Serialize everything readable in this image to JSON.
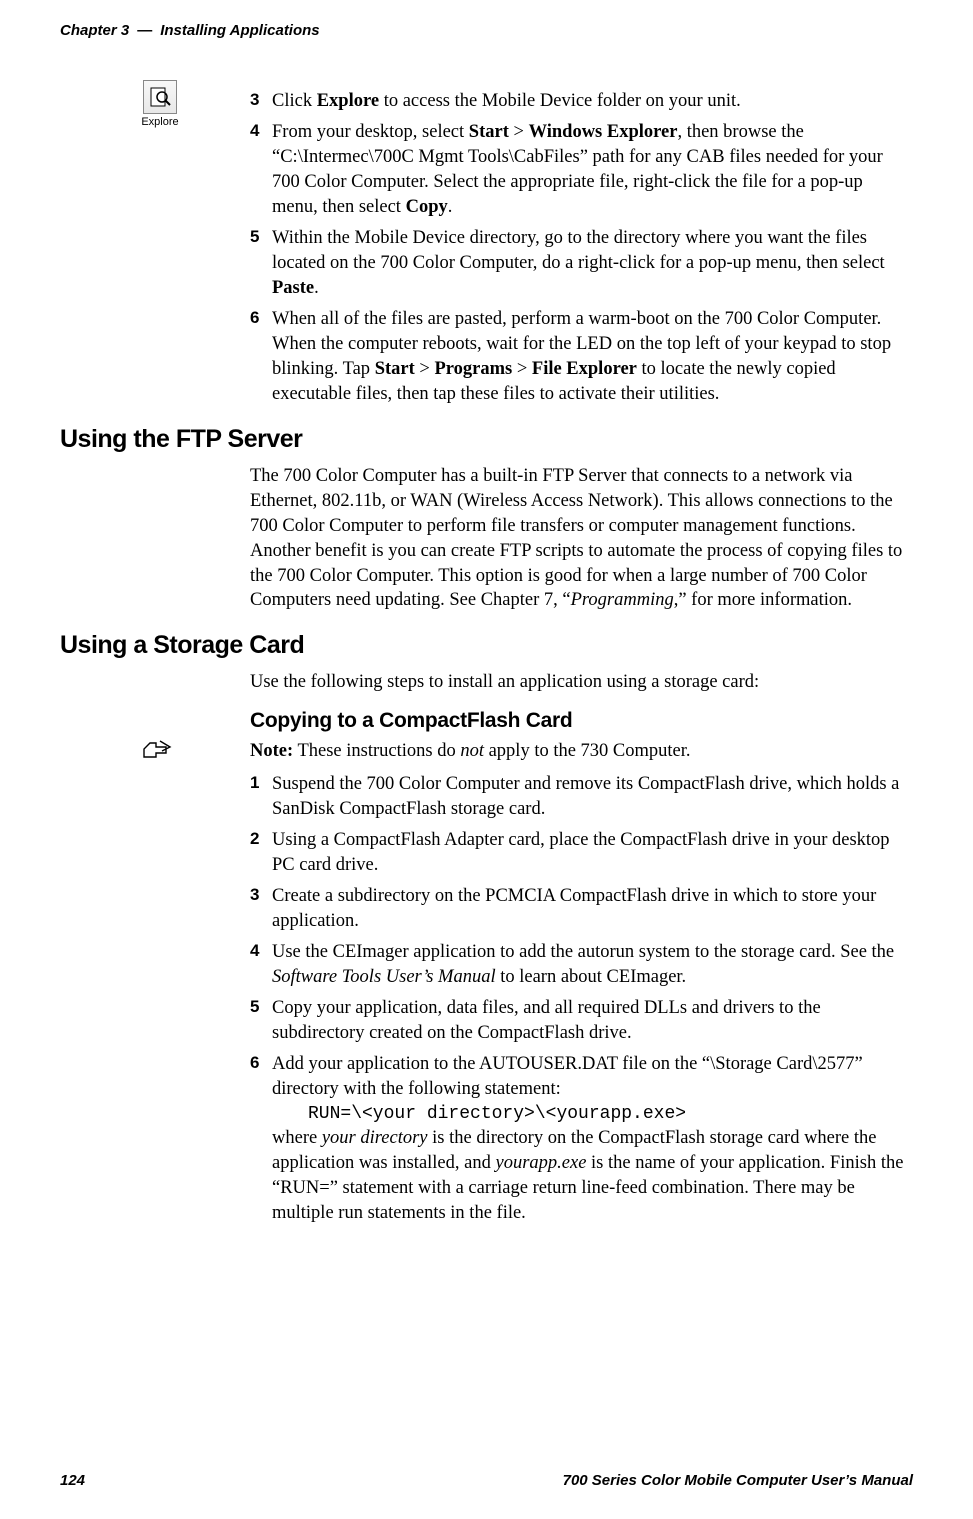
{
  "header": {
    "chapter": "Chapter 3",
    "dash": "—",
    "title": "Installing Applications"
  },
  "explore": {
    "label": "Explore"
  },
  "top_steps": {
    "s3": {
      "num": "3",
      "pre": "Click ",
      "bold1": "Explore",
      "post": " to access the Mobile Device folder on your unit."
    },
    "s4": {
      "num": "4",
      "t1": "From your desktop, select ",
      "b1": "Start",
      "gt1": " > ",
      "b2": "Windows Explorer",
      "t2": ", then browse the “C:\\Intermec\\700C Mgmt Tools\\CabFiles” path for any CAB files needed for your 700 Color Computer. Select the appropriate file, right-click the file for a pop-up menu, then select ",
      "b3": "Copy",
      "t3": "."
    },
    "s5": {
      "num": "5",
      "t1": "Within the Mobile Device directory, go to the directory where you want the files located on the 700 Color Computer, do a right-click for a pop-up menu, then select ",
      "b1": "Paste",
      "t2": "."
    },
    "s6": {
      "num": "6",
      "t1": "When all of the files are pasted, perform a warm-boot on the 700 Color Computer. When the computer reboots, wait for the LED on the top left of your keypad to stop blinking. Tap ",
      "b1": "Start",
      "gt1": " > ",
      "b2": "Programs",
      "gt2": " > ",
      "b3": "File Explorer",
      "t2": " to locate the newly copied executable files, then tap these files to activate their utilities."
    }
  },
  "ftp": {
    "heading": "Using the FTP Server",
    "p1a": "The 700 Color Computer has a built-in FTP Server that connects to a network via Ethernet, 802.11b, or WAN (Wireless Access Network). This allows connections to the 700 Color Computer to perform file transfers or computer management functions. Another benefit is you can create FTP scripts to automate the process of copying files to the 700 Color Computer. This option is good for when a large number of 700 Color Computers need updating. See Chapter 7, “",
    "p1i": "Programming",
    "p1b": ",” for more information."
  },
  "storage": {
    "heading": "Using a Storage Card",
    "intro": "Use the following steps to install an application using a storage card:",
    "sub": "Copying to a CompactFlash Card",
    "note_b": "Note:",
    "note_t1": " These instructions do ",
    "note_i": "not",
    "note_t2": " apply to the 730 Computer.",
    "steps": {
      "s1": {
        "num": "1",
        "text": "Suspend the 700 Color Computer and remove its CompactFlash drive, which holds a SanDisk CompactFlash storage card."
      },
      "s2": {
        "num": "2",
        "text": "Using a CompactFlash Adapter card, place the CompactFlash drive in your desktop PC card drive."
      },
      "s3": {
        "num": "3",
        "text": "Create a subdirectory on the PCMCIA CompactFlash drive in which to store your application."
      },
      "s4": {
        "num": "4",
        "t1": "Use the CEImager application to add the autorun system to the storage card. See the ",
        "i1": "Software Tools User’s Manual",
        "t2": " to learn about CEImager."
      },
      "s5": {
        "num": "5",
        "text": "Copy your application, data files, and all required DLLs and drivers to the subdirectory created on the CompactFlash drive."
      },
      "s6": {
        "num": "6",
        "t1": "Add your application to the AUTOUSER.DAT file on the “\\Storage Card\\2577” directory with the following statement:",
        "code": "RUN=\\<your directory>\\<yourapp.exe>",
        "t2a": "where ",
        "i1": "your directory",
        "t2b": " is the directory on the CompactFlash storage card where the application was installed, and ",
        "i2": "yourapp.exe",
        "t2c": " is the name of your application. Finish the “RUN=” statement with a carriage return line-feed combination. There may be multiple run statements in the file."
      }
    }
  },
  "footer": {
    "page": "124",
    "title": "700 Series Color Mobile Computer User’s Manual"
  }
}
